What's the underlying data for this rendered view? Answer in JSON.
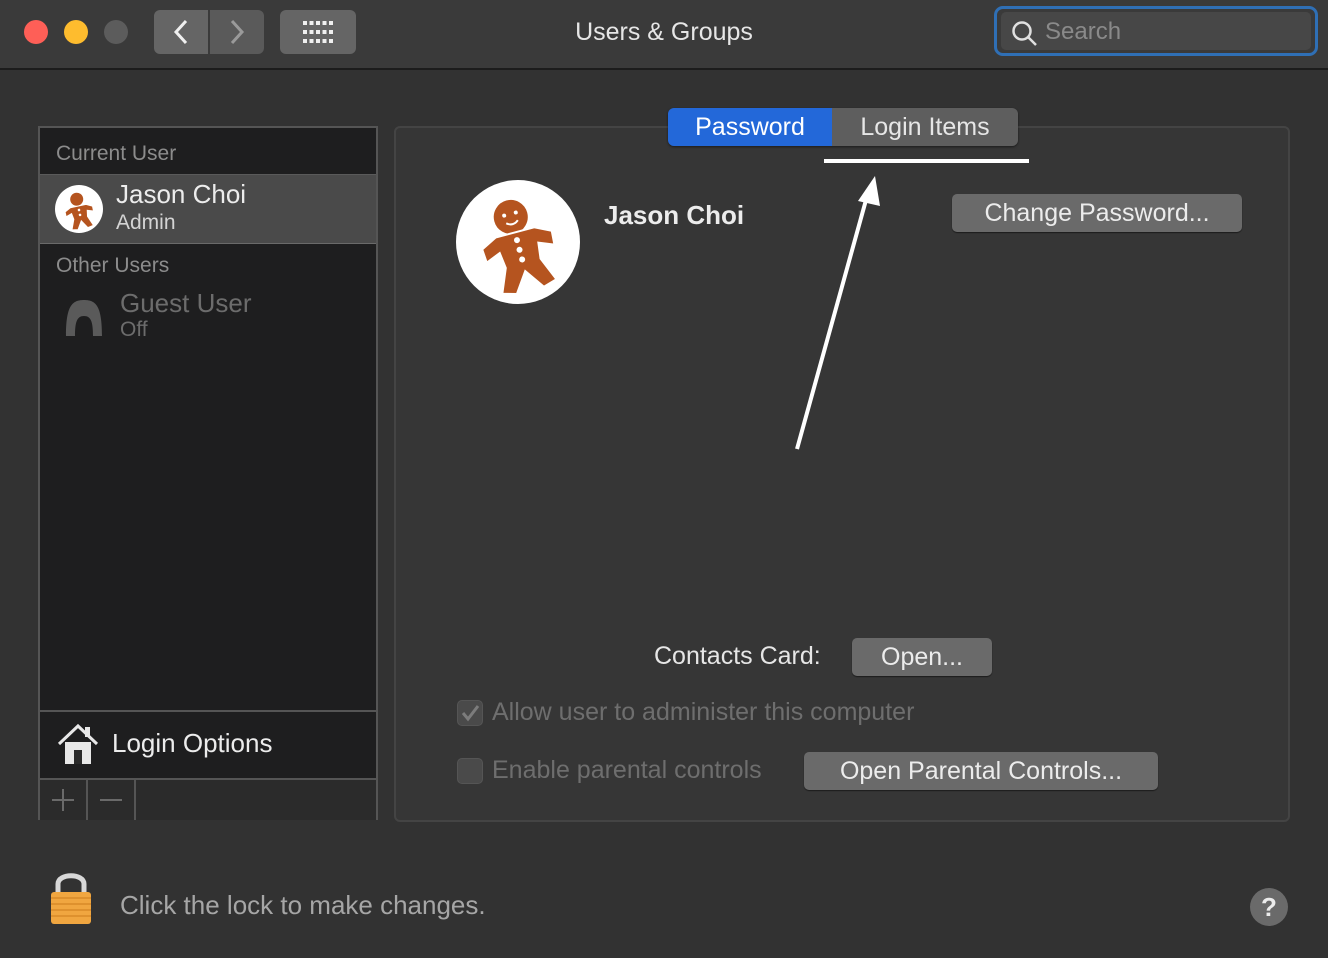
{
  "window": {
    "title": "Users & Groups",
    "search_placeholder": "Search"
  },
  "sidebar": {
    "current_user_label": "Current User",
    "current_user": {
      "name": "Jason Choi",
      "role": "Admin"
    },
    "other_users_label": "Other Users",
    "other_users": [
      {
        "name": "Guest User",
        "status": "Off"
      }
    ],
    "login_options_label": "Login Options",
    "add_icon": "plus-icon",
    "remove_icon": "minus-icon"
  },
  "tabs": [
    {
      "label": "Password",
      "active": true
    },
    {
      "label": "Login Items",
      "active": false
    }
  ],
  "main": {
    "user_name": "Jason Choi",
    "change_password_label": "Change Password...",
    "contacts_card_label": "Contacts Card:",
    "open_label": "Open...",
    "allow_admin_label": "Allow user to administer this computer",
    "allow_admin_checked": true,
    "parental_controls_label": "Enable parental controls",
    "parental_controls_checked": false,
    "open_parental_label": "Open Parental Controls..."
  },
  "footer": {
    "lock_text": "Click the lock to make changes.",
    "help_label": "?"
  },
  "colors": {
    "accent": "#2368d9",
    "close": "#fe5f57",
    "minimize": "#febc2e",
    "lock": "#f0a640"
  }
}
